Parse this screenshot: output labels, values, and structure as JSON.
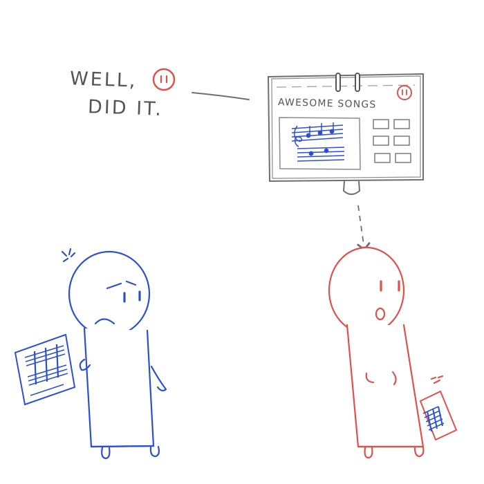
{
  "speech": {
    "line1": "WELL,",
    "line2": "DID IT."
  },
  "monitor": {
    "title": "AWESOME SONGS"
  },
  "colors": {
    "pencil": "#6e6e6e",
    "blue_character": "#2a4fd0",
    "red_character": "#e0504a",
    "background": "#ffffff"
  },
  "icons": [
    "red-face-icon",
    "music-staff-icon",
    "anger-mark-icon",
    "sweat-mark-icon",
    "dashed-arrow-icon"
  ]
}
